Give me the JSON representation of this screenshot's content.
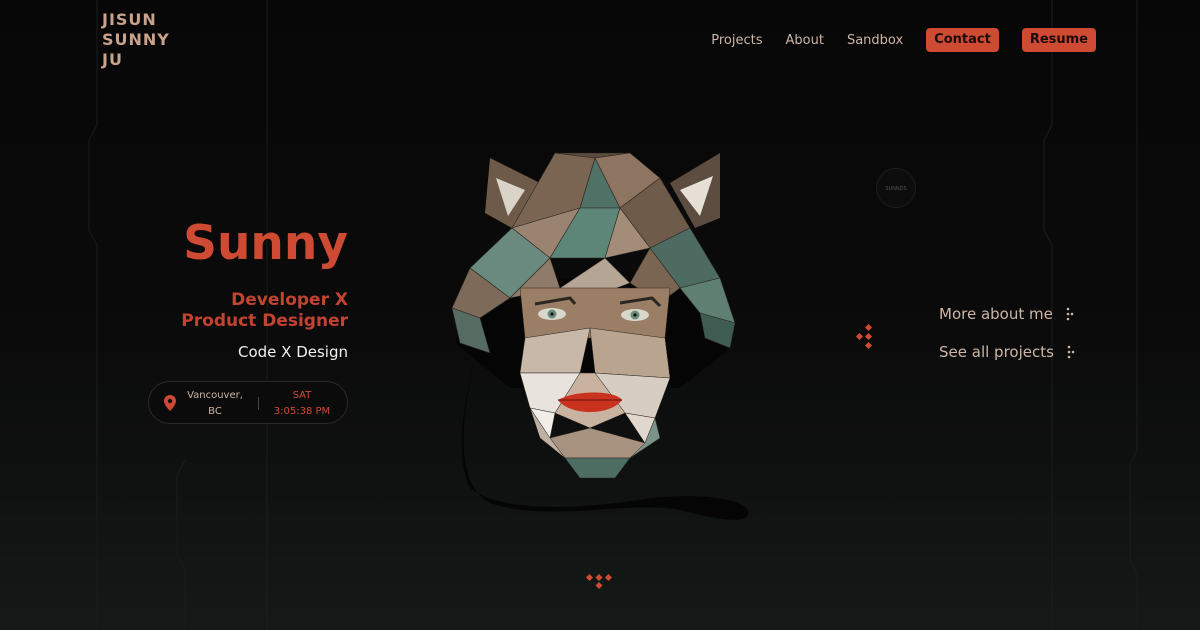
{
  "logo": {
    "lines": [
      "JISUN",
      "SUNNY",
      "JU"
    ]
  },
  "nav": {
    "links": [
      "Projects",
      "About",
      "Sandbox"
    ],
    "buttons": [
      "Contact",
      "Resume"
    ]
  },
  "hero": {
    "name": "Sunny",
    "roles": [
      "Developer X",
      "Product Designer"
    ],
    "tagline": "Code X Design"
  },
  "location_pill": {
    "city": "Vancouver,",
    "region": "BC",
    "day": "SAT",
    "time": "3:05:38 PM"
  },
  "side_links": [
    "More about me",
    "See all projects"
  ],
  "badge": {
    "text": "SUNNDS"
  },
  "colors": {
    "accent": "#cf4a33",
    "text_muted": "#cdb6a6",
    "logo": "#c9a28c",
    "background": "#0a0a0a"
  },
  "icons": [
    "location-pin-icon",
    "dots-arrow-icon",
    "diamond-cluster-icon",
    "scroll-down-icon"
  ]
}
